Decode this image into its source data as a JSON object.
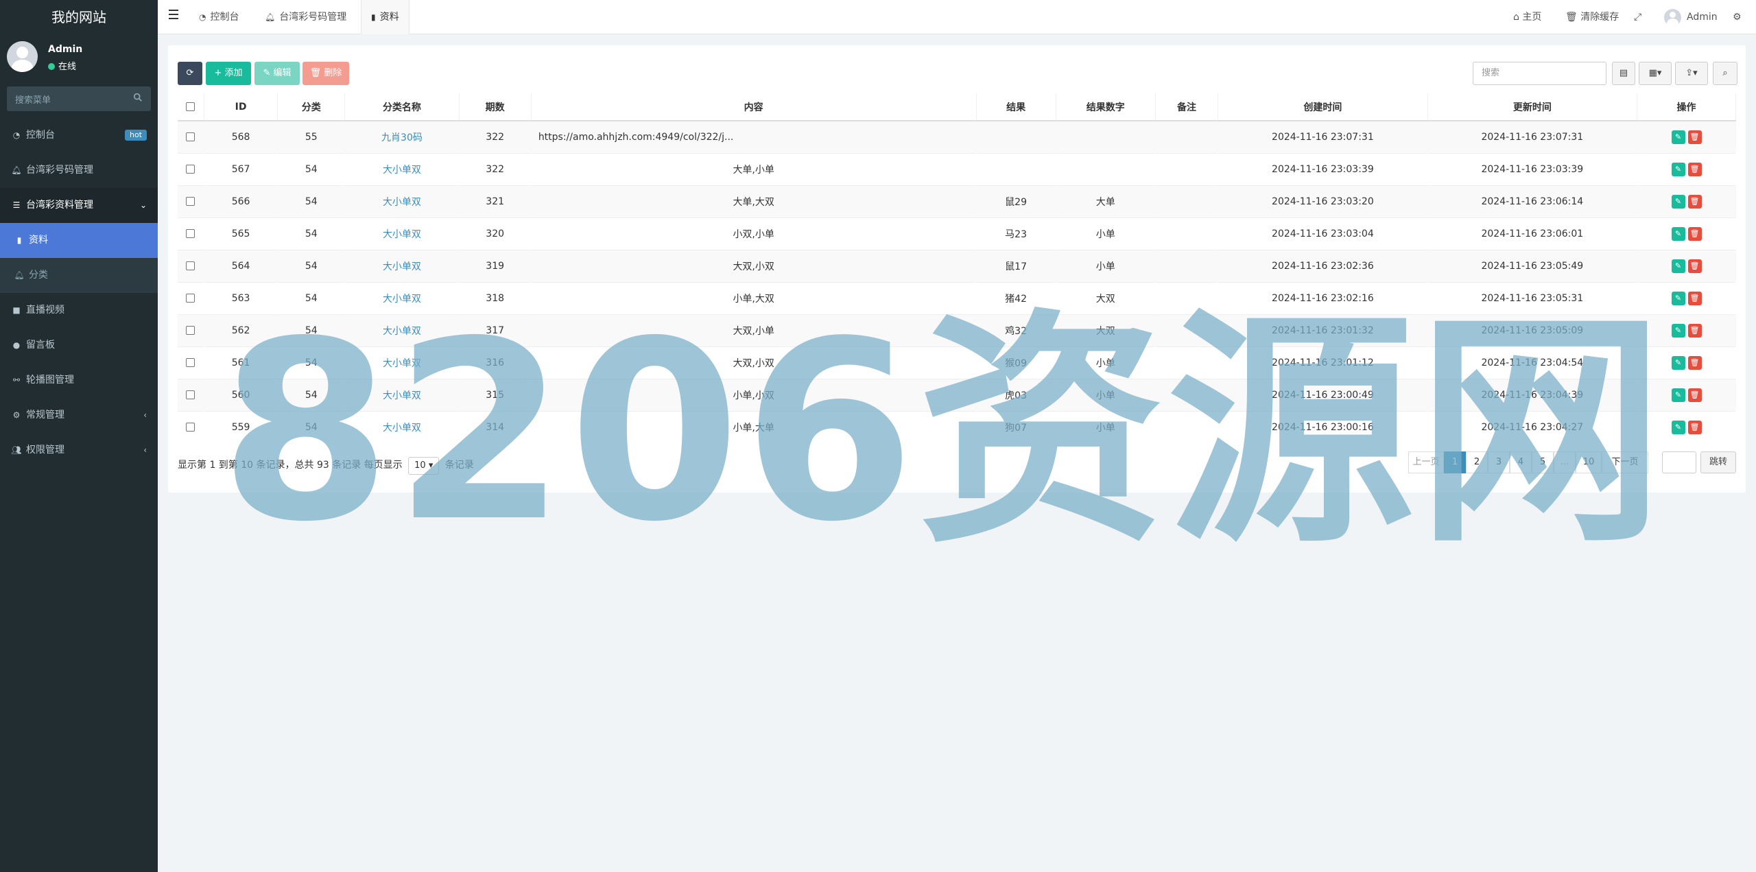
{
  "sidebar": {
    "site_name": "我的网站",
    "user": {
      "name": "Admin",
      "status": "在线"
    },
    "search_placeholder": "搜索菜单",
    "items": [
      {
        "label": "控制台",
        "badge": "hot",
        "icon": "dashboard-icon"
      },
      {
        "label": "台湾彩号码管理",
        "icon": "bell-icon"
      },
      {
        "label": "台湾彩资料管理",
        "icon": "list-icon",
        "caret": "⌄"
      },
      {
        "label": "资料",
        "icon": "bookmark-icon"
      },
      {
        "label": "分类",
        "icon": "bell-icon"
      },
      {
        "label": "直播视频",
        "icon": "video-icon"
      },
      {
        "label": "留言板",
        "icon": "comment-icon"
      },
      {
        "label": "轮播图管理",
        "icon": "link-icon"
      },
      {
        "label": "常规管理",
        "icon": "cogs-icon",
        "caret": "‹"
      },
      {
        "label": "权限管理",
        "icon": "users-icon",
        "caret": "‹"
      }
    ]
  },
  "topbar": {
    "tabs": [
      {
        "label": "控制台",
        "icon": "dashboard-icon"
      },
      {
        "label": "台湾彩号码管理",
        "icon": "bell-icon"
      },
      {
        "label": "资料",
        "icon": "bookmark-icon"
      }
    ],
    "home": "主页",
    "clear_cache": "清除缓存",
    "user": "Admin"
  },
  "toolbar": {
    "add": "添加",
    "edit": "编辑",
    "delete": "删除",
    "search_placeholder": "搜索"
  },
  "table": {
    "columns": [
      "ID",
      "分类",
      "分类名称",
      "期数",
      "内容",
      "结果",
      "结果数字",
      "备注",
      "创建时间",
      "更新时间",
      "操作"
    ],
    "rows": [
      {
        "id": "568",
        "cat": "55",
        "cat_name": "九肖30码",
        "period": "322",
        "content": "https://amo.ahhjzh.com:4949/col/322/j...",
        "result": "",
        "result_num": "",
        "note": "",
        "created": "2024-11-16 23:07:31",
        "updated": "2024-11-16 23:07:31"
      },
      {
        "id": "567",
        "cat": "54",
        "cat_name": "大小单双",
        "period": "322",
        "content": "大单,小单",
        "result": "",
        "result_num": "",
        "note": "",
        "created": "2024-11-16 23:03:39",
        "updated": "2024-11-16 23:03:39"
      },
      {
        "id": "566",
        "cat": "54",
        "cat_name": "大小单双",
        "period": "321",
        "content": "大单,大双",
        "result": "鼠29",
        "result_num": "大单",
        "note": "",
        "created": "2024-11-16 23:03:20",
        "updated": "2024-11-16 23:06:14"
      },
      {
        "id": "565",
        "cat": "54",
        "cat_name": "大小单双",
        "period": "320",
        "content": "小双,小单",
        "result": "马23",
        "result_num": "小单",
        "note": "",
        "created": "2024-11-16 23:03:04",
        "updated": "2024-11-16 23:06:01"
      },
      {
        "id": "564",
        "cat": "54",
        "cat_name": "大小单双",
        "period": "319",
        "content": "大双,小双",
        "result": "鼠17",
        "result_num": "小单",
        "note": "",
        "created": "2024-11-16 23:02:36",
        "updated": "2024-11-16 23:05:49"
      },
      {
        "id": "563",
        "cat": "54",
        "cat_name": "大小单双",
        "period": "318",
        "content": "小单,大双",
        "result": "猪42",
        "result_num": "大双",
        "note": "",
        "created": "2024-11-16 23:02:16",
        "updated": "2024-11-16 23:05:31"
      },
      {
        "id": "562",
        "cat": "54",
        "cat_name": "大小单双",
        "period": "317",
        "content": "大双,小单",
        "result": "鸡32",
        "result_num": "大双",
        "note": "",
        "created": "2024-11-16 23:01:32",
        "updated": "2024-11-16 23:05:09"
      },
      {
        "id": "561",
        "cat": "54",
        "cat_name": "大小单双",
        "period": "316",
        "content": "大双,小双",
        "result": "猴09",
        "result_num": "小单",
        "note": "",
        "created": "2024-11-16 23:01:12",
        "updated": "2024-11-16 23:04:54"
      },
      {
        "id": "560",
        "cat": "54",
        "cat_name": "大小单双",
        "period": "315",
        "content": "小单,小双",
        "result": "虎03",
        "result_num": "小单",
        "note": "",
        "created": "2024-11-16 23:00:49",
        "updated": "2024-11-16 23:04:39"
      },
      {
        "id": "559",
        "cat": "54",
        "cat_name": "大小单双",
        "period": "314",
        "content": "小单,大单",
        "result": "狗07",
        "result_num": "小单",
        "note": "",
        "created": "2024-11-16 23:00:16",
        "updated": "2024-11-16 23:04:27"
      }
    ]
  },
  "footer": {
    "info_prefix": "显示第 1 到第 10 条记录，总共 93 条记录 每页显示",
    "page_size": "10",
    "info_suffix": "条记录",
    "prev": "上一页",
    "pages": [
      "1",
      "2",
      "3",
      "4",
      "5",
      "...",
      "10"
    ],
    "next": "下一页",
    "jump": "跳转"
  },
  "watermark": "8206资源网"
}
